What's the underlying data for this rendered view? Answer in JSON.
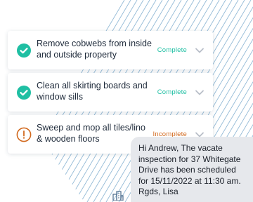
{
  "tasks": [
    {
      "label": "Remove cobwebs from inside and outside property",
      "status": "Complete",
      "status_icon": "check-circle-icon",
      "status_color": "#1fbfa3"
    },
    {
      "label": "Clean all skirting boards and window sills",
      "status": "Complete",
      "status_icon": "check-circle-icon",
      "status_color": "#1fbfa3"
    },
    {
      "label": "Sweep and mop all tiles/lino & wooden floors",
      "status": "Incomplete",
      "status_icon": "alert-circle-icon",
      "status_color": "#d2691e"
    }
  ],
  "message": {
    "text": "Hi Andrew, The vacate inspection for 37 Whitegate Drive has been scheduled for 15/11/2022 at 11:30 am. Rgds, Lisa"
  },
  "colors": {
    "accent": "#1fbfa3",
    "warning": "#d2691e",
    "hatch": "#6fa3c9",
    "bubble": "#e6e8ec"
  }
}
